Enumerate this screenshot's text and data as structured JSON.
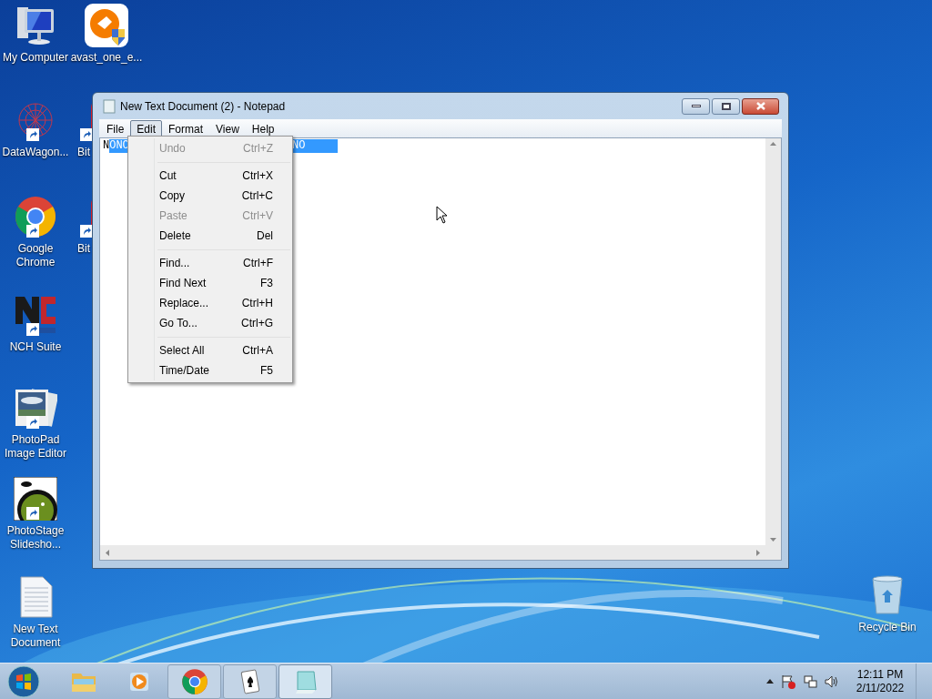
{
  "desktop_icons": [
    {
      "label": "My Computer",
      "kind": "computer"
    },
    {
      "label": "avast_one_e...",
      "kind": "avast"
    },
    {
      "label": "DataWagon...",
      "kind": "datawagon"
    },
    {
      "label": "Bit",
      "kind": "bit"
    },
    {
      "label": "Google Chrome",
      "kind": "chrome"
    },
    {
      "label": "Bit",
      "kind": "bit"
    },
    {
      "label": "NCH Suite",
      "kind": "nch"
    },
    {
      "label": "PhotoPad Image Editor",
      "kind": "photopad"
    },
    {
      "label": "PhotoStage Slidesho...",
      "kind": "photostage"
    },
    {
      "label": "New Text Document",
      "kind": "textfile"
    },
    {
      "label": "Recycle Bin",
      "kind": "recycle"
    }
  ],
  "window": {
    "title": "New Text Document (2) - Notepad",
    "menu_bar": [
      {
        "label": "File",
        "selected": false
      },
      {
        "label": "Edit",
        "selected": true
      },
      {
        "label": "Format",
        "selected": false
      },
      {
        "label": "View",
        "selected": false
      },
      {
        "label": "Help",
        "selected": false
      }
    ],
    "text_lead": "N",
    "text_selected_left": "ONC",
    "text_selected_right": "NO"
  },
  "edit_menu": [
    {
      "kind": "item",
      "label": "Undo",
      "shortcut": "Ctrl+Z",
      "disabled": true
    },
    {
      "kind": "separator"
    },
    {
      "kind": "item",
      "label": "Cut",
      "shortcut": "Ctrl+X",
      "disabled": false
    },
    {
      "kind": "item",
      "label": "Copy",
      "shortcut": "Ctrl+C",
      "disabled": false
    },
    {
      "kind": "item",
      "label": "Paste",
      "shortcut": "Ctrl+V",
      "disabled": true
    },
    {
      "kind": "item",
      "label": "Delete",
      "shortcut": "Del",
      "disabled": false
    },
    {
      "kind": "separator"
    },
    {
      "kind": "item",
      "label": "Find...",
      "shortcut": "Ctrl+F",
      "disabled": false
    },
    {
      "kind": "item",
      "label": "Find Next",
      "shortcut": "F3",
      "disabled": false
    },
    {
      "kind": "item",
      "label": "Replace...",
      "shortcut": "Ctrl+H",
      "disabled": false
    },
    {
      "kind": "item",
      "label": "Go To...",
      "shortcut": "Ctrl+G",
      "disabled": false
    },
    {
      "kind": "separator"
    },
    {
      "kind": "item",
      "label": "Select All",
      "shortcut": "Ctrl+A",
      "disabled": false
    },
    {
      "kind": "item",
      "label": "Time/Date",
      "shortcut": "F5",
      "disabled": false
    }
  ],
  "taskbar": {
    "apps": [
      {
        "kind": "explorer",
        "selected": false
      },
      {
        "kind": "media",
        "selected": false
      },
      {
        "kind": "chrome",
        "selected": false
      },
      {
        "kind": "cards",
        "selected": false
      },
      {
        "kind": "notepad",
        "selected": true
      }
    ],
    "time": "12:11 PM",
    "date": "2/11/2022"
  }
}
